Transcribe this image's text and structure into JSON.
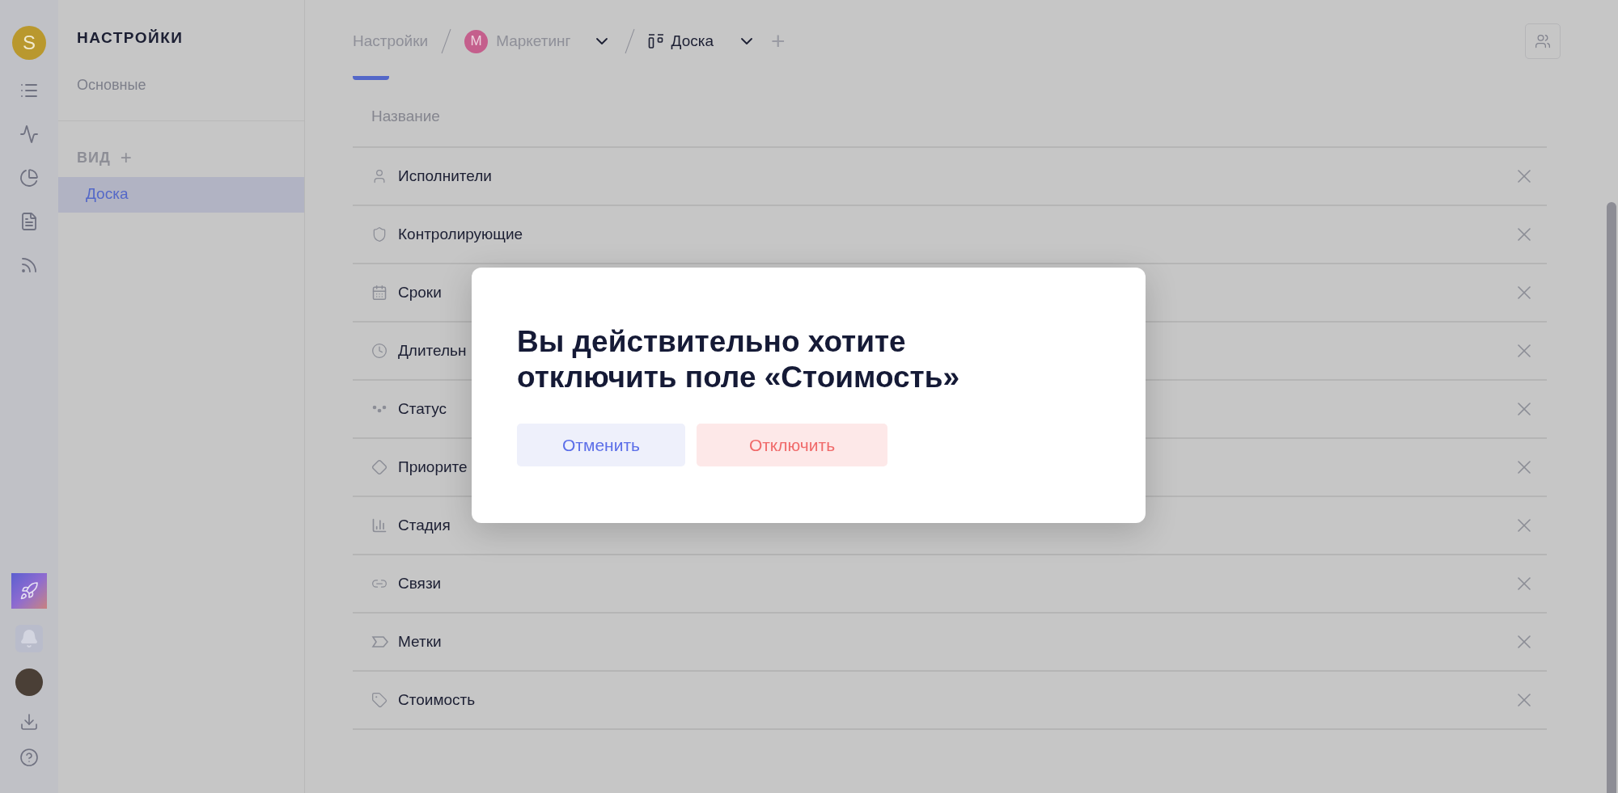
{
  "rail": {
    "user_initial": "S"
  },
  "sidebar": {
    "title": "НАСТРОЙКИ",
    "items": [
      {
        "label": "Основные",
        "selected": false
      }
    ],
    "section": {
      "title": "ВИД",
      "add": "+"
    },
    "views": [
      {
        "label": "Доска",
        "selected": true
      }
    ]
  },
  "breadcrumb": {
    "root": "Настройки",
    "project_initial": "М",
    "project": "Маркетинг",
    "view": "Доска",
    "add": "+"
  },
  "table": {
    "column": "Название",
    "rows": [
      {
        "label": "Исполнители"
      },
      {
        "label": "Контролирующие"
      },
      {
        "label": "Сроки"
      },
      {
        "label": "Длительн"
      },
      {
        "label": "Статус"
      },
      {
        "label": "Приорите"
      },
      {
        "label": "Стадия"
      },
      {
        "label": "Связи"
      },
      {
        "label": "Метки"
      },
      {
        "label": "Стоимость"
      }
    ]
  },
  "dialog": {
    "title": "Вы действительно хотите отключить поле «Стоимость»",
    "buttons": [
      {
        "label": "Отменить",
        "kind": "cancel"
      },
      {
        "label": "Отключить",
        "kind": "danger"
      }
    ]
  }
}
